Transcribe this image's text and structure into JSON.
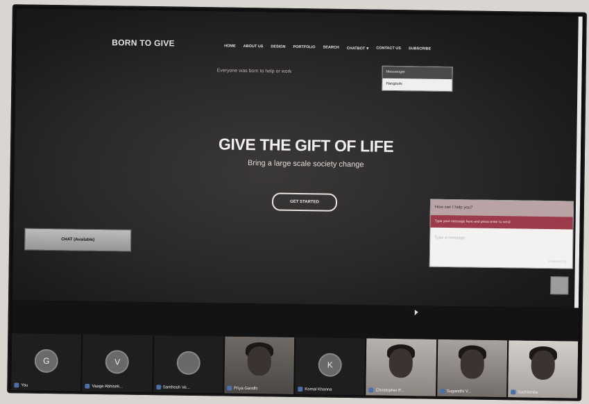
{
  "website": {
    "brand": "BORN TO GIVE",
    "nav": [
      "HOME",
      "ABOUT US",
      "DESIGN",
      "PORTFOLIO",
      "SEARCH",
      "CHATBOT",
      "CONTACT US",
      "SUBSCRIBE"
    ],
    "nav_caret_after_index": 5,
    "tagline": "Everyone was born to help or work",
    "dropdown": {
      "items": [
        "Messenger",
        "Hangouts"
      ]
    },
    "hero_title": "GIVE THE GIFT OF LIFE",
    "hero_subtitle": "Bring a large scale society change",
    "cta_label": "GET STARTED",
    "side_button_label": "CHAT (Available)",
    "chat_widget": {
      "header": "How can I help you?",
      "subheader": "Type your message here and press enter to send",
      "input_placeholder": "Type a message...",
      "footer": "Powered by"
    }
  },
  "participants": [
    {
      "initial": "G",
      "name": "You",
      "video": false
    },
    {
      "initial": "V",
      "name": "Vaage Abhisek...",
      "video": false
    },
    {
      "initial": "",
      "name": "Santhosh Ve...",
      "video": false
    },
    {
      "initial": "",
      "name": "Priya Gandhi",
      "video": true
    },
    {
      "initial": "K",
      "name": "Komal Khanna",
      "video": false
    },
    {
      "initial": "",
      "name": "Christopher P...",
      "video": true
    },
    {
      "initial": "",
      "name": "Sugandhi V...",
      "video": true
    },
    {
      "initial": "",
      "name": "Suchismita",
      "video": true
    }
  ],
  "colors": {
    "hero_bg": "#2a2828",
    "chat_accent": "#9c3b4a",
    "mic_badge": "#4c6fa8"
  }
}
